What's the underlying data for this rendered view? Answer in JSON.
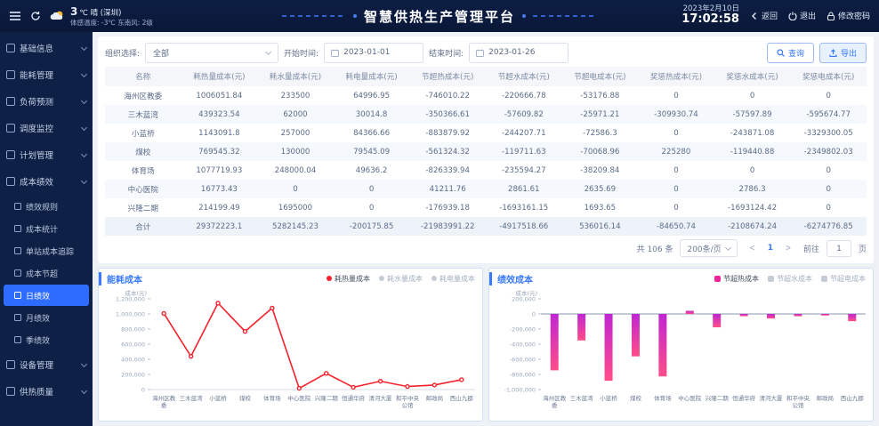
{
  "topbar": {
    "weather": {
      "temp": "3",
      "summary": "℃ 晴 (深圳)",
      "detail": "体感温度: -3℃ 东南风: 2级"
    },
    "title": "智慧供热生产管理平台",
    "date": "2023年2月10日",
    "time": "17:02:58",
    "back_label": "返回",
    "logout_label": "退出",
    "change_password_label": "修改密码"
  },
  "sidebar": {
    "items": [
      {
        "label": "基础信息",
        "icon": "base-info-icon"
      },
      {
        "label": "能耗管理",
        "icon": "energy-icon"
      },
      {
        "label": "负荷预测",
        "icon": "forecast-icon"
      },
      {
        "label": "调度监控",
        "icon": "monitor-icon"
      },
      {
        "label": "计划管理",
        "icon": "plan-icon"
      },
      {
        "label": "成本绩效",
        "icon": "cost-performance-icon",
        "expanded": true,
        "children": [
          {
            "label": "绩效规则",
            "icon": "rule-icon"
          },
          {
            "label": "成本统计",
            "icon": "stats-icon"
          },
          {
            "label": "单站成本追踪",
            "icon": "trace-icon"
          },
          {
            "label": "成本节超",
            "icon": "saving-icon"
          },
          {
            "label": "日绩效",
            "icon": "daily-icon",
            "active": true
          },
          {
            "label": "月绩效",
            "icon": "monthly-icon"
          },
          {
            "label": "季绩效",
            "icon": "quarterly-icon"
          }
        ]
      },
      {
        "label": "设备管理",
        "icon": "device-icon"
      },
      {
        "label": "供热质量",
        "icon": "quality-icon"
      }
    ]
  },
  "filters": {
    "org_label": "组织选择:",
    "org_value": "全部",
    "start_label": "开始时间:",
    "start_value": "2023-01-01",
    "end_label": "结束时间:",
    "end_value": "2023-01-26",
    "search_label": "查询",
    "export_label": "导出"
  },
  "table": {
    "columns": [
      "名称",
      "耗热量成本(元)",
      "耗水量成本(元)",
      "耗电量成本(元)",
      "节超热成本(元)",
      "节超水成本(元)",
      "节超电成本(元)",
      "奖惩热成本(元)",
      "奖惩水成本(元)",
      "奖惩电成本(元)"
    ],
    "rows": [
      [
        "海州区教委",
        "1006051.84",
        "233500",
        "64996.95",
        "-746010.22",
        "-220666.78",
        "-53176.88",
        "0",
        "0",
        "0"
      ],
      [
        "三木蓝湾",
        "439323.54",
        "62000",
        "30014.8",
        "-350366.61",
        "-57609.82",
        "-25971.21",
        "-309930.74",
        "-57597.89",
        "-595674.77"
      ],
      [
        "小蓝桥",
        "1143091.8",
        "257000",
        "84366.66",
        "-883879.92",
        "-244207.71",
        "-72586.3",
        "0",
        "-243871.08",
        "-3329300.05"
      ],
      [
        "煤校",
        "769545.32",
        "130000",
        "79545.09",
        "-561324.32",
        "-119711.63",
        "-70068.96",
        "225280",
        "-119440.88",
        "-2349802.03"
      ],
      [
        "体育场",
        "1077719.93",
        "248000.04",
        "49636.2",
        "-826339.94",
        "-235594.27",
        "-38209.84",
        "0",
        "0",
        "0"
      ],
      [
        "中心医院",
        "16773.43",
        "0",
        "0",
        "41211.76",
        "2861.61",
        "2635.69",
        "0",
        "2786.3",
        "0"
      ],
      [
        "兴隆二期",
        "214199.49",
        "1695000",
        "0",
        "-176939.18",
        "-1693161.15",
        "1693.65",
        "0",
        "-1693124.42",
        "0"
      ],
      [
        "合计",
        "29372223.1",
        "5282145.23",
        "-200175.85",
        "-21983991.22",
        "-4917518.66",
        "536016.14",
        "-84650.74",
        "-2108674.24",
        "-6274776.85"
      ]
    ]
  },
  "pagination": {
    "total_text": "共 106 条",
    "page_size": "200条/页",
    "current_page": "1",
    "goto_label": "前往",
    "goto_value": "1",
    "goto_suffix": "页"
  },
  "chart_data": [
    {
      "type": "line",
      "title": "能耗成本",
      "ylabel": "成本(元)",
      "legend": [
        {
          "label": "耗热量成本",
          "active": true
        },
        {
          "label": "耗水量成本",
          "active": false
        },
        {
          "label": "耗电量成本",
          "active": false
        }
      ],
      "categories": [
        "海州区教委",
        "三木蓝湾",
        "小蓝桥",
        "煤校",
        "体育场",
        "中心医院",
        "兴隆二期",
        "恒通华府",
        "清河大厦",
        "和平中央公馆",
        "邮政局",
        "西山九郡"
      ],
      "series": [
        {
          "name": "耗热量成本",
          "values": [
            1006051.84,
            439323.54,
            1143091.8,
            769545.32,
            1077719.93,
            16773.43,
            214199.49,
            30000,
            110000,
            40000,
            60000,
            130000
          ]
        }
      ],
      "ylim": [
        0,
        1200000
      ],
      "ytick_step": 200000,
      "color": "#f5222d",
      "legend_color": "#f5222d"
    },
    {
      "type": "bar",
      "title": "绩效成本",
      "ylabel": "成本(元)",
      "legend": [
        {
          "label": "节超热成本",
          "active": true
        },
        {
          "label": "节超水成本",
          "active": false
        },
        {
          "label": "节超电成本",
          "active": false
        }
      ],
      "categories": [
        "海州区教委",
        "三木蓝湾",
        "小蓝桥",
        "煤校",
        "体育场",
        "中心医院",
        "兴隆二期",
        "恒通华府",
        "清河大厦",
        "和平中央公馆",
        "邮政局",
        "西山九郡"
      ],
      "series": [
        {
          "name": "节超热成本",
          "values": [
            -746010.22,
            -350366.61,
            -883879.92,
            -561324.32,
            -826339.94,
            41211.76,
            -176939.18,
            -30000,
            -60000,
            -30000,
            -20000,
            -95000
          ]
        }
      ],
      "ylim": [
        -1000000,
        200000
      ],
      "ytick_step": 200000,
      "colors": [
        "#c026d3",
        "#ff4d88"
      ],
      "legend_color": "#f5239b"
    }
  ]
}
